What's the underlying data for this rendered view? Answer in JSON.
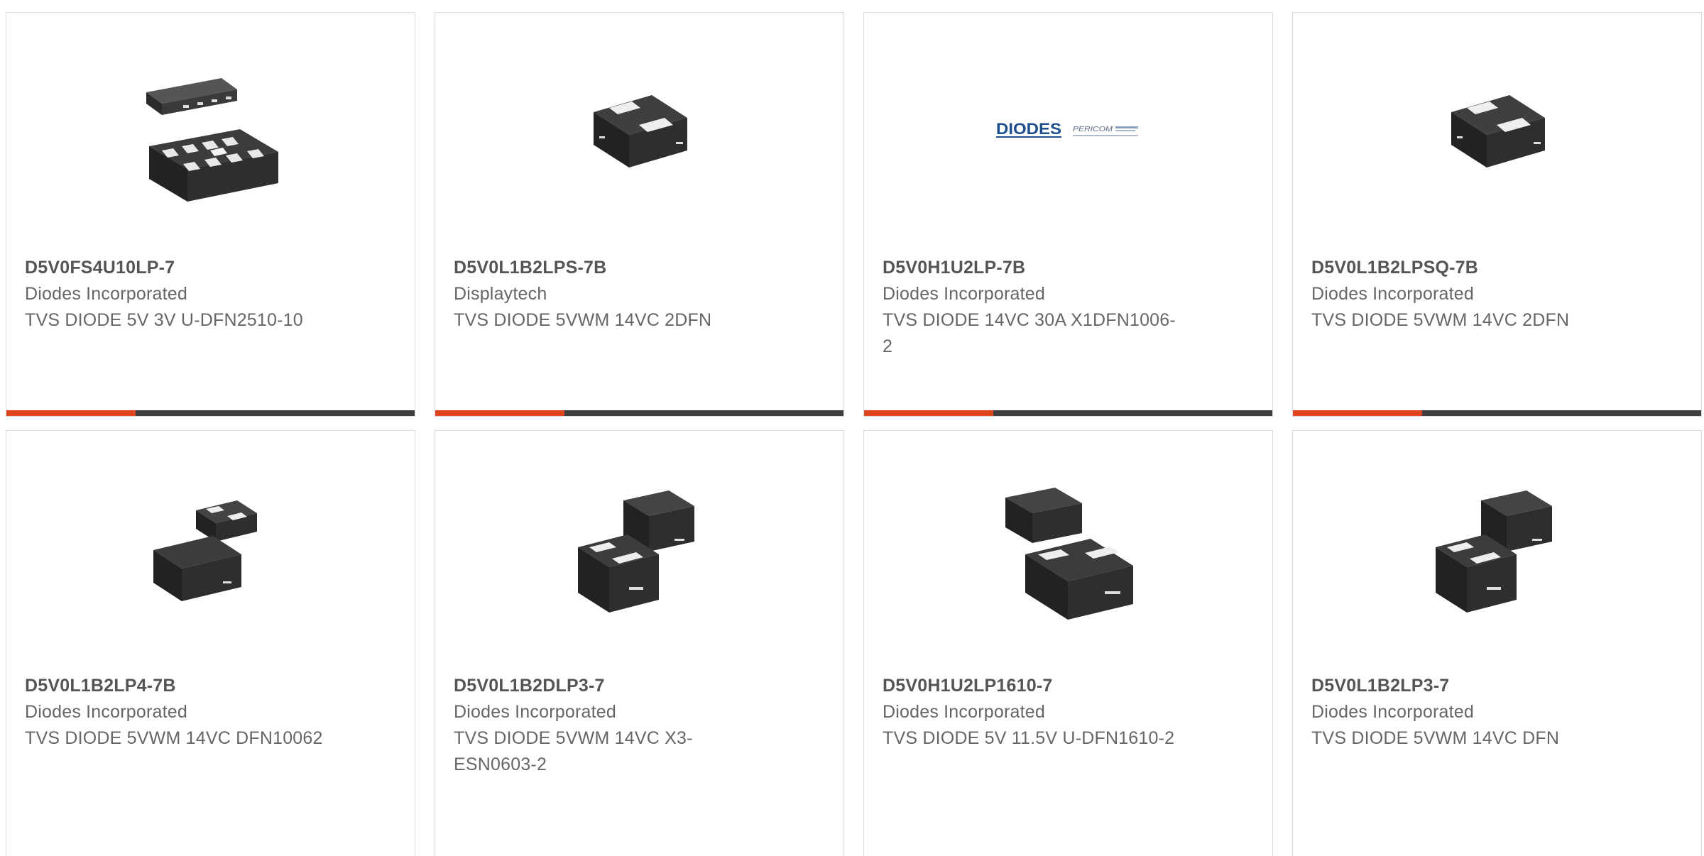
{
  "colors": {
    "accent": "#e0441c",
    "bar": "#3f3f3f",
    "border": "#dcdcdc",
    "part_number": "#555555",
    "text": "#666666"
  },
  "products": [
    {
      "part_number": "D5V0FS4U10LP-7",
      "manufacturer": "Diodes Incorporated",
      "description": "TVS DIODE 5V 3V U-DFN2510-10",
      "image": "chip-10-pin-icon"
    },
    {
      "part_number": "D5V0L1B2LPS-7B",
      "manufacturer": "Displaytech",
      "description": "TVS DIODE 5VWM 14VC 2DFN",
      "image": "chip-2-pad-icon"
    },
    {
      "part_number": "D5V0H1U2LP-7B",
      "manufacturer": "Diodes Incorporated",
      "description": "TVS DIODE 14VC 30A X1DFN1006-2",
      "image": "diodes-pericom-logo"
    },
    {
      "part_number": "D5V0L1B2LPSQ-7B",
      "manufacturer": "Diodes Incorporated",
      "description": "TVS DIODE 5VWM 14VC 2DFN",
      "image": "chip-2-pad-icon"
    },
    {
      "part_number": "D5V0L1B2LP4-7B",
      "manufacturer": "Diodes Incorporated",
      "description": "TVS DIODE 5VWM 14VC DFN10062",
      "image": "chip-pair-icon"
    },
    {
      "part_number": "D5V0L1B2DLP3-7",
      "manufacturer": "Diodes Incorporated",
      "description": "TVS DIODE 5VWM 14VC X3-ESN0603-2",
      "image": "chip-pair-icon"
    },
    {
      "part_number": "D5V0H1U2LP1610-7",
      "manufacturer": "Diodes Incorporated",
      "description": "TVS DIODE 5V 11.5V U-DFN1610-2",
      "image": "chip-pair-icon"
    },
    {
      "part_number": "D5V0L1B2LP3-7",
      "manufacturer": "Diodes Incorporated",
      "description": "TVS DIODE 5VWM 14VC DFN",
      "image": "chip-pair-icon"
    }
  ]
}
